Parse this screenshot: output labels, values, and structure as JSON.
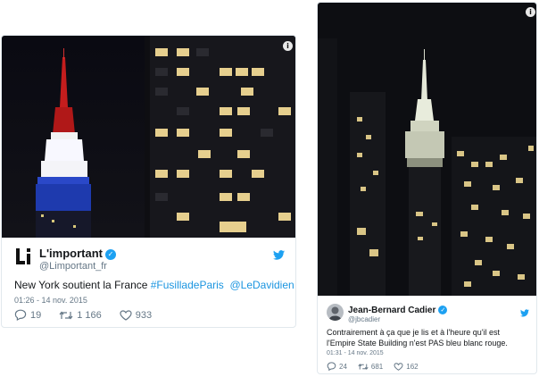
{
  "tweets": [
    {
      "display_name": "L'important",
      "handle": "@Limportant_fr",
      "text_parts": {
        "plain": "New York soutient la France ",
        "hashtag": "#FusilladeParis",
        "mention": "@LeDavidien"
      },
      "timestamp": "01:26 - 14 nov. 2015",
      "replies": "19",
      "retweets": "1 166",
      "likes": "933",
      "avatar_letters": "Li",
      "image_info_glyph": "i",
      "verified_glyph": "✓"
    },
    {
      "display_name": "Jean-Bernard Cadier",
      "handle": "@jbcadier",
      "text": "Contrairement à ça que je lis et à l'heure qu'il est l'Empire State Building n'est PAS bleu blanc rouge.",
      "timestamp": "01:31 - 14 nov. 2015",
      "replies": "24",
      "retweets": "681",
      "likes": "162",
      "image_info_glyph": "i",
      "verified_glyph": "✓"
    }
  ],
  "colors": {
    "link": "#1b95e0",
    "twitter_blue": "#1da1f2",
    "muted": "#657786",
    "border": "#e1e8ed"
  },
  "icons": [
    "info-icon",
    "verified-badge-icon",
    "twitter-bird-icon",
    "reply-icon",
    "retweet-icon",
    "like-icon"
  ]
}
